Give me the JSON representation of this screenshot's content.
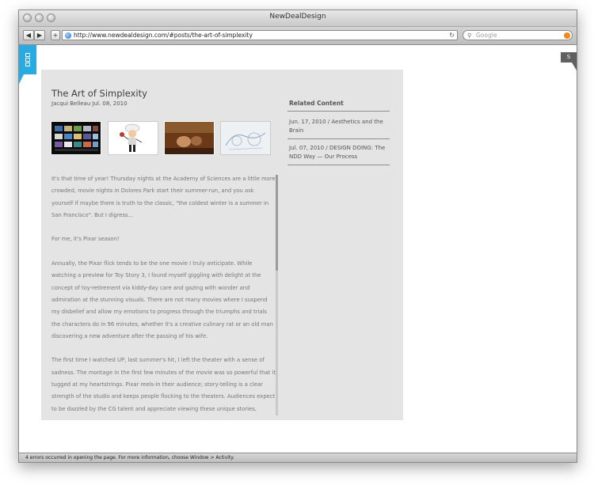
{
  "window": {
    "title": "NewDealDesign"
  },
  "toolbar": {
    "back_label": "◀",
    "forward_label": "▶",
    "add_label": "+",
    "url": "http://www.newdealdesign.com/#posts/the-art-of-simplexity",
    "reload_label": "↻",
    "search_placeholder": "Google"
  },
  "site": {
    "s_tab_label": "S"
  },
  "post": {
    "title": "The Art of Simplexity",
    "meta": "Jacqui Belleau Jul. 08, 2010",
    "paragraphs": [
      "It's that time of year! Thursday nights at the Academy of Sciences are a little more crowded, movie nights in Dolores Park start their summer-run, and you ask yourself if maybe there is truth to the classic, \"the coldest winter is a summer in San Francisco\". But I digress...",
      "For me, it's Pixar season!",
      "Annually, the Pixar flick tends to be the one movie I truly anticipate. While watching a preview for Toy Story 3, I found myself giggling with delight at the concept of toy-retirement via kiddy-day care and gazing with wonder and admiration at the stunning visuals. There are not many movies where I suspend my disbelief and allow my emotions to progress through the triumphs and trials the characters do in 96 minutes, whether it's a creative culinary rat or an old man discovering a new adventure after the passing of his wife.",
      "The first time I watched UP, last summer's hit, I left the theater with a sense of sadness. The montage in the first few minutes of the movie was so powerful that it tugged at my heartstrings. Pixar reels-in their audience; story-telling is a clear strength of the studio and keeps people flocking to the theaters. Audiences expect to be dazzled by the CG talent and appreciate viewing these unique stories, especially when other summer"
    ]
  },
  "related": {
    "heading": "Related Content",
    "items": [
      "Jun. 17, 2010 / Aesthetics and the Brain",
      "Jul. 07, 2010 / DESIGN DOING: The NDD Way — Our Process"
    ]
  },
  "status": {
    "text": "4 errors occurred in opening the page. For more information, choose Window > Activity."
  },
  "colors": {
    "accent_blue": "#29abe2",
    "panel_gray": "#e4e4e4",
    "s_tab_gray": "#606060"
  }
}
